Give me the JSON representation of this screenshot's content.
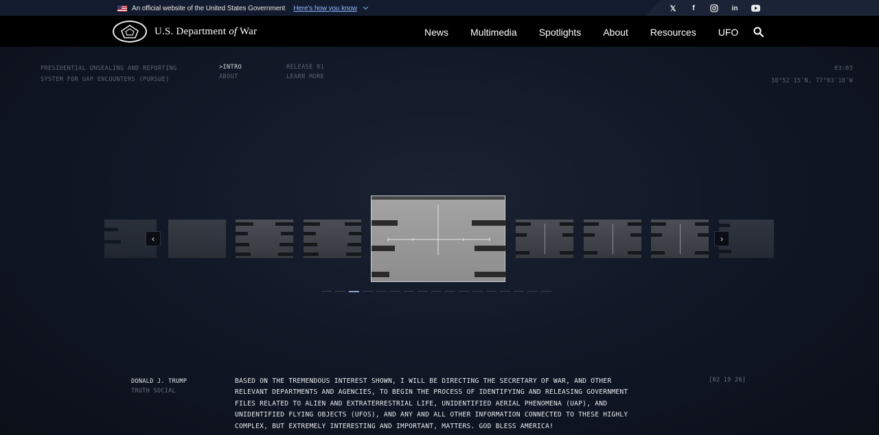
{
  "gov_banner": {
    "text": "An official website of the United States Government",
    "link": "Here's how you know"
  },
  "social": {
    "icons": [
      "x-icon",
      "facebook-icon",
      "instagram-icon",
      "linkedin-icon",
      "youtube-icon"
    ]
  },
  "nav": {
    "logo_prefix": "U.S. Department ",
    "logo_of": "of",
    "logo_suffix": " War",
    "links": [
      "News",
      "Multimedia",
      "Spotlights",
      "About",
      "Resources",
      "UFO"
    ]
  },
  "hero": {
    "program_line1": "PRESIDENTIAL UNSEALING AND REPORTING",
    "program_line2": "SYSTEM FOR UAP ENCOUNTERS (PURSUE)",
    "menu": {
      "intro": ">INTRO",
      "about": "ABOUT",
      "release": "RELEASE 01",
      "learn_more": "LEARN MORE"
    },
    "time": "03:03",
    "coordinates": "38°52′15″N, 77°03′18″W"
  },
  "carousel": {
    "slide_count": 17,
    "active_index": 2,
    "prev_symbol": "‹",
    "next_symbol": "›"
  },
  "quote": {
    "author": "DONALD J. TRUMP",
    "source": "TRUTH SOCIAL",
    "text": "BASED ON THE TREMENDOUS INTEREST SHOWN, I WILL BE DIRECTING THE SECRETARY OF WAR, AND OTHER RELEVANT DEPARTMENTS AND AGENCIES, TO BEGIN THE PROCESS OF IDENTIFYING AND RELEASING GOVERNMENT FILES RELATED TO ALIEN AND EXTRATERRESTRIAL LIFE, UNIDENTIFIED AERIAL PHENOMENA (UAP), AND UNIDENTIFIED FLYING OBJECTS (UFOS), AND ANY AND ALL OTHER INFORMATION CONNECTED TO THESE HIGHLY COMPLEX, BUT EXTREMELY INTERESTING AND IMPORTANT, MATTERS. GOD BLESS AMERICA!",
    "date": "[02 19 26]"
  }
}
